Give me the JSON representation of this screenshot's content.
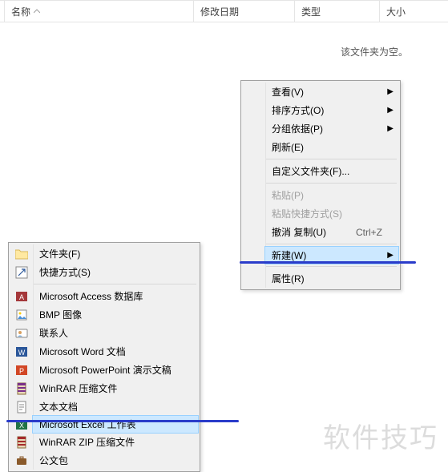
{
  "columns": {
    "name": "名称",
    "modified": "修改日期",
    "type": "类型",
    "size": "大小"
  },
  "empty_message": "该文件夹为空。",
  "context_menu": {
    "view": "查看(V)",
    "sort": "排序方式(O)",
    "group": "分组依据(P)",
    "refresh": "刷新(E)",
    "customize": "自定义文件夹(F)...",
    "paste": "粘贴(P)",
    "paste_shortcut": "粘贴快捷方式(S)",
    "undo_copy": "撤消 复制(U)",
    "undo_shortcut": "Ctrl+Z",
    "new": "新建(W)",
    "properties": "属性(R)"
  },
  "new_submenu": {
    "folder": "文件夹(F)",
    "shortcut": "快捷方式(S)",
    "access": "Microsoft Access 数据库",
    "bmp": "BMP 图像",
    "contact": "联系人",
    "word": "Microsoft Word 文档",
    "ppt": "Microsoft PowerPoint 演示文稿",
    "rar": "WinRAR 压缩文件",
    "txt": "文本文档",
    "excel": "Microsoft Excel 工作表",
    "zip": "WinRAR ZIP 压缩文件",
    "briefcase": "公文包"
  },
  "watermark": "软件技巧"
}
